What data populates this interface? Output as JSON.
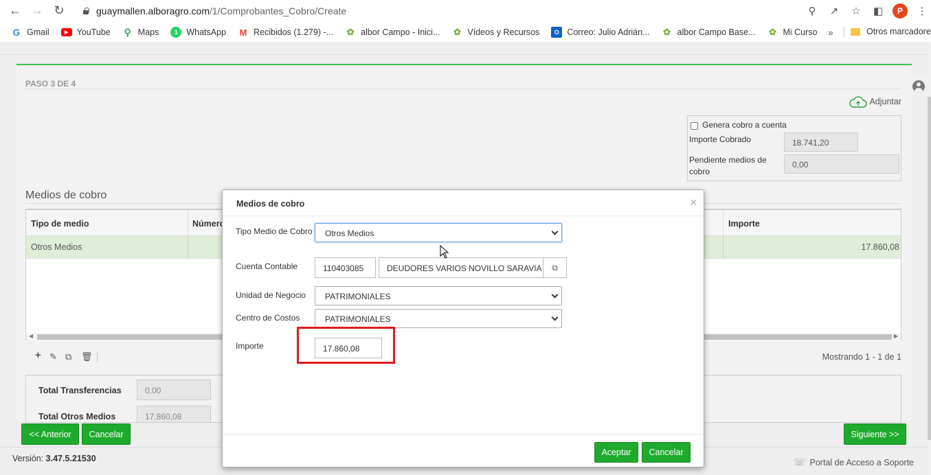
{
  "browser": {
    "url_host": "guaymallen.alboragro.com",
    "url_path": "/1/Comprobantes_Cobro/Create",
    "avatar_letter": "P",
    "bookmarks": [
      {
        "label": "Gmail",
        "icon": "gmail-icon"
      },
      {
        "label": "YouTube",
        "icon": "youtube-icon"
      },
      {
        "label": "Maps",
        "icon": "maps-icon"
      },
      {
        "label": "WhatsApp",
        "icon": "whatsapp-icon"
      },
      {
        "label": "Recibidos (1.279) -...",
        "icon": "gmail-m-icon"
      },
      {
        "label": "albor Campo - Inici...",
        "icon": "sprout-icon"
      },
      {
        "label": "Vídeos y Recursos",
        "icon": "sprout-icon"
      },
      {
        "label": "Correo: Julio Adrián...",
        "icon": "outlook-icon"
      },
      {
        "label": "albor Campo Base...",
        "icon": "sprout-icon"
      },
      {
        "label": "Mi Curso",
        "icon": "sprout-icon"
      }
    ],
    "bookmarks_more": "»",
    "other_bookmarks": "Otros marcadores"
  },
  "page": {
    "step": "PASO 3 DE 4",
    "attach_label": "Adjuntar",
    "summary": {
      "generate_label": "Genera cobro a cuenta",
      "importe_cobrado_label": "Importe Cobrado",
      "importe_cobrado_value": "18.741,20",
      "pendiente_label_1": "Pendiente medios de",
      "pendiente_label_2": "cobro",
      "pendiente_value": "0,00"
    },
    "section_title": "Medios de cobro",
    "grid": {
      "columns": [
        "Tipo de medio",
        "Número",
        "Importe"
      ],
      "rows": [
        {
          "tipo": "Otros Medios",
          "importe": "17.860,08"
        }
      ],
      "showing": "Mostrando 1 - 1 de 1"
    },
    "totals": [
      {
        "label": "Total Transferencias",
        "value": "0,00"
      },
      {
        "label": "Total Otros Medios",
        "value": "17.860,08"
      }
    ],
    "buttons": {
      "prev": "<< Anterior",
      "cancel": "Cancelar",
      "next": "Siguiente >>"
    },
    "version_label": "Versión:",
    "version_value": "3.47.5.21530",
    "support": "Portal de Acceso a Soporte"
  },
  "modal": {
    "title": "Medios de cobro",
    "close": "×",
    "tipo_label": "Tipo Medio de Cobro",
    "tipo_value": "Otros Medios",
    "cuenta_label": "Cuenta Contable",
    "cuenta_code": "110403085",
    "cuenta_name": "DEUDORES VARIOS NOVILLO SARAVIA",
    "unidad_label": "Unidad de Negocio",
    "unidad_value": "PATRIMONIALES",
    "centro_label": "Centro de Costos",
    "centro_value": "PATRIMONIALES",
    "importe_label": "Importe",
    "importe_value": "17.860,08",
    "accept": "Aceptar",
    "cancel": "Cancelar"
  },
  "colors": {
    "accent_green": "#1eaa2c",
    "highlight_red": "#e01b1b",
    "row_selected": "#dfeed9"
  }
}
